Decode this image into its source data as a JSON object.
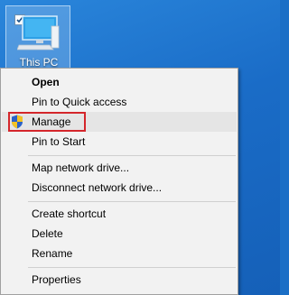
{
  "desktop": {
    "icon_label": "This PC",
    "icon_name": "computer-icon"
  },
  "context_menu": {
    "items": [
      {
        "label": "Open"
      },
      {
        "label": "Pin to Quick access"
      },
      {
        "label": "Manage",
        "icon": "uac-shield-icon",
        "highlighted": true
      },
      {
        "label": "Pin to Start"
      },
      {
        "label": "Map network drive..."
      },
      {
        "label": "Disconnect network drive..."
      },
      {
        "label": "Create shortcut"
      },
      {
        "label": "Delete"
      },
      {
        "label": "Rename"
      },
      {
        "label": "Properties"
      }
    ]
  },
  "colors": {
    "desktop_bg": "#1a6cc7",
    "menu_bg": "#f2f2f2",
    "highlight_border": "#d4262b",
    "hover_bg": "#e5e5e5"
  }
}
